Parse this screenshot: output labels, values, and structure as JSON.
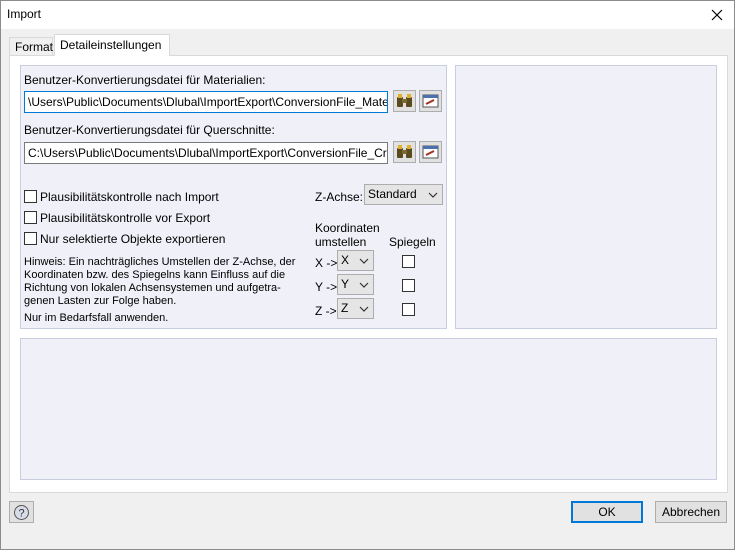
{
  "window": {
    "title": "Import"
  },
  "tabs": [
    {
      "label": "Format"
    },
    {
      "label": "Detaileinstellungen"
    }
  ],
  "materials": {
    "label": "Benutzer-Konvertierungsdatei für Materialien:",
    "path": "\\Users\\Public\\Documents\\Dlubal\\ImportExport\\ConversionFile_Material.txt"
  },
  "crosssections": {
    "label": "Benutzer-Konvertierungsdatei für Querschnitte:",
    "path": "C:\\Users\\Public\\Documents\\Dlubal\\ImportExport\\ConversionFile_CrossSect"
  },
  "options": {
    "plausibility_import": "Plausibilitätskontrolle nach Import",
    "plausibility_export": "Plausibilitätskontrolle vor Export",
    "selected_only": "Nur selektierte Objekte exportieren"
  },
  "zaxis": {
    "label": "Z-Achse:",
    "value": "Standard"
  },
  "coords": {
    "header_line1": "Koordinaten",
    "header_line2": "umstellen",
    "mirror_header": "Spiegeln",
    "rows": [
      {
        "label": "X ->",
        "value": "X"
      },
      {
        "label": "Y ->",
        "value": "Y"
      },
      {
        "label": "Z ->",
        "value": "Z"
      }
    ]
  },
  "hint": {
    "lines": [
      "Hinweis: Ein nachträgliches Umstellen der Z-Achse, der",
      "Koordinaten bzw. des Spiegelns kann Einfluss auf die",
      "Richtung von lokalen Achsensystemen und aufgetra-",
      "genen Lasten zur Folge haben."
    ],
    "note": "Nur im Bedarfsfall anwenden."
  },
  "buttons": {
    "ok": "OK",
    "cancel": "Abbrechen"
  },
  "colors": {
    "focus_border": "#0078d7",
    "panel_bg": "#f0f0f8"
  }
}
